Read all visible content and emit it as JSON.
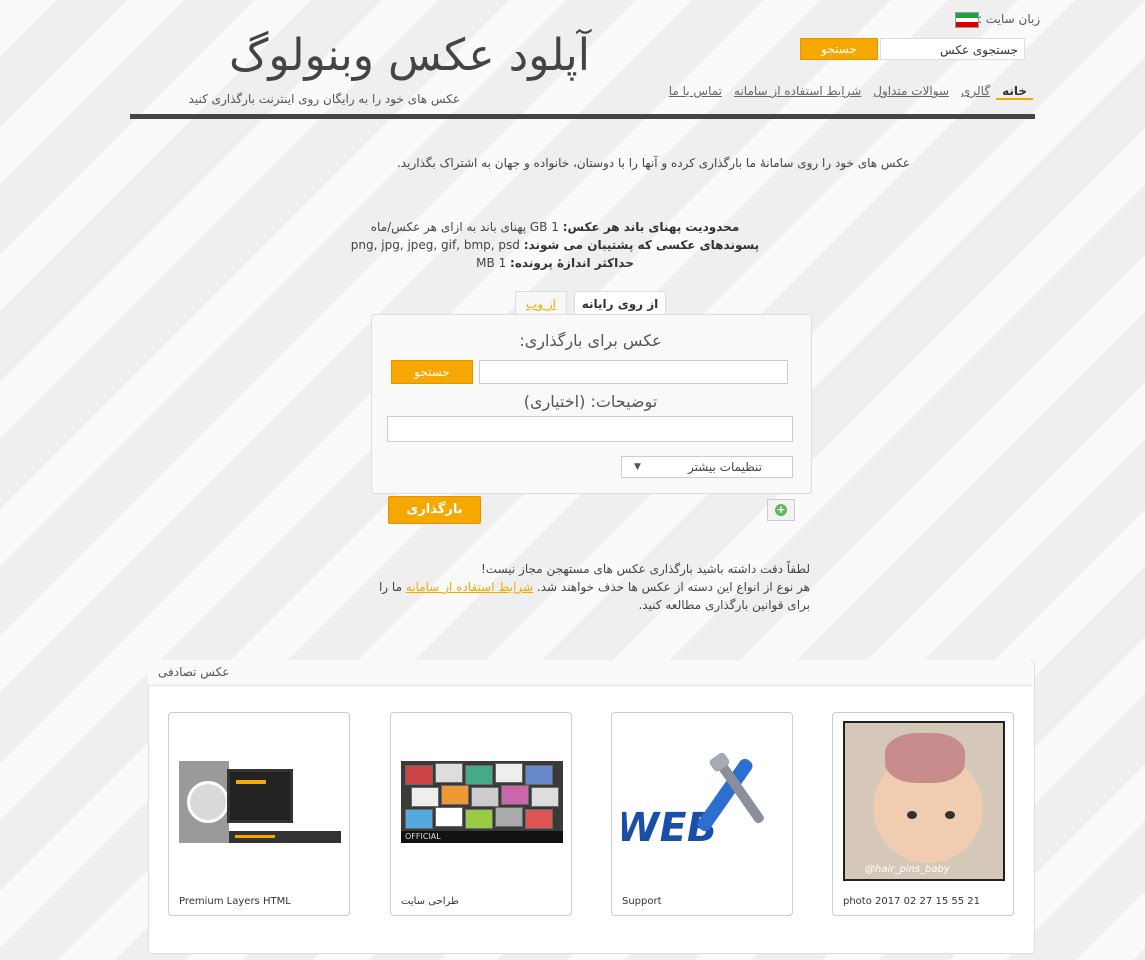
{
  "header": {
    "lang_label": "زبان سایت :",
    "search_value": "جستجوی عکس",
    "search_button": "جستجو",
    "logo": "آپلود عکس وبنولوگ",
    "tagline": "عکس های خود را به رایگان روی اینترنت بارگذاری کنید",
    "nav": [
      {
        "label": "خانه"
      },
      {
        "label": "گالری"
      },
      {
        "label": "سوالات متداول"
      },
      {
        "label": "شرایط استفاده از سامانه"
      },
      {
        "label": "تماس با ما"
      }
    ]
  },
  "intro": "عکس های خود را روی سامانهٔ ما بارگذاری کرده و آنها را با دوستان، خانواده و جهان به اشتراک بگذارید.",
  "limits": {
    "bandwidth_label": "محدودیت پهنای باند هر عکس:",
    "bandwidth_value": "1 GB پهنای باند به ازای هر عکس/ماه",
    "ext_label": "پسوندهای عکسی که پشتیبان می شوند:",
    "ext_value": "png, jpg, jpeg, gif, bmp, psd",
    "size_label": "حداکثر اندازهٔ پرونده:",
    "size_value": "1 MB"
  },
  "upload": {
    "tab_computer": "از روی رایانه",
    "tab_web": "از وب",
    "image_label": "عکس برای بارگذاری:",
    "browse_button": "جستجو",
    "desc_label": "توضیحات: (اختیاری)",
    "settings_label": "تنظیمات بیشتر",
    "upload_button": "بارگذاری",
    "add_symbol": "+"
  },
  "warning": {
    "line1": "لطفاً دقت داشته باشید بارگذاری عکس های مستهجن مجاز نیست!",
    "line2_pre": "هر نوع از انواع این دسته از عکس ها حذف خواهند شد.",
    "link": "شرایط استفاده از سامانه",
    "line2_post": "ما را",
    "line3": "برای قوانین بارگذاری مطالعه کنید."
  },
  "gallery": {
    "title": "عکس تصادفی",
    "items": [
      {
        "caption": "Premium Layers HTML"
      },
      {
        "caption": "طراحی سایت"
      },
      {
        "caption": "Support"
      },
      {
        "caption": "photo 2017 02 27 15 55 21"
      }
    ],
    "thumb_texts": {
      "official": "OFFICIAL",
      "web": "WEB",
      "hashtag": "@hair_pins_baby"
    }
  },
  "colors": {
    "accent": "#f6a800",
    "flag": [
      "#239f40",
      "#ffffff",
      "#da0000"
    ]
  }
}
